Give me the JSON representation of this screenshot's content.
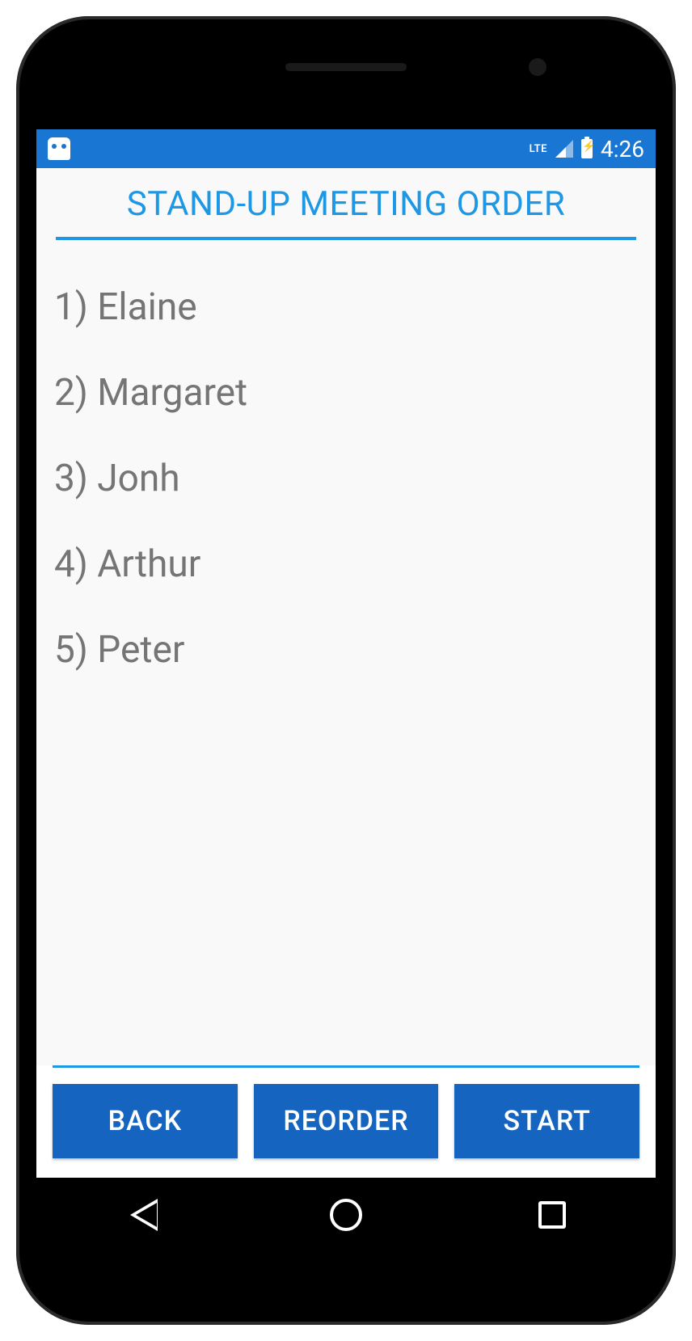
{
  "status": {
    "network_label": "LTE",
    "time": "4:26"
  },
  "page": {
    "title": "STAND-UP MEETING ORDER"
  },
  "list": {
    "items": [
      {
        "text": "1) Elaine"
      },
      {
        "text": "2) Margaret"
      },
      {
        "text": "3) Jonh"
      },
      {
        "text": "4) Arthur"
      },
      {
        "text": "5) Peter"
      }
    ]
  },
  "buttons": {
    "back": "BACK",
    "reorder": "REORDER",
    "start": "START"
  }
}
